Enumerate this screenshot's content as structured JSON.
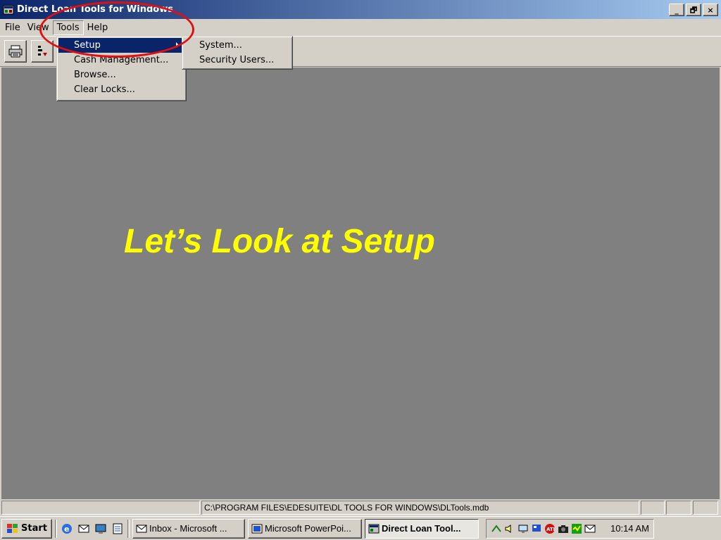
{
  "window": {
    "title": "Direct Loan Tools for Windows",
    "minimize_label": "_",
    "maximize_label": "🗗",
    "close_label": "×"
  },
  "menubar": {
    "items": [
      {
        "label": "File"
      },
      {
        "label": "View"
      },
      {
        "label": "Tools"
      },
      {
        "label": "Help"
      }
    ]
  },
  "tools_menu": {
    "items": [
      {
        "label": "Setup",
        "highlighted": true,
        "has_submenu": true
      },
      {
        "label": "Cash Management..."
      },
      {
        "label": "Browse..."
      },
      {
        "label": "Clear Locks..."
      }
    ]
  },
  "setup_submenu": {
    "items": [
      {
        "label": "System..."
      },
      {
        "label": "Security Users..."
      }
    ]
  },
  "toolbar": {
    "buttons": [
      {
        "icon": "printer-icon"
      },
      {
        "icon": "sort-icon"
      }
    ]
  },
  "slide": {
    "overlay_text": "Let’s Look at Setup",
    "overlay_color": "#ffff00",
    "annotation_color": "#e01010"
  },
  "statusbar": {
    "path": "C:\\PROGRAM FILES\\EDESUITE\\DL TOOLS FOR WINDOWS\\DLTools.mdb"
  },
  "taskbar": {
    "start_label": "Start",
    "tasks": [
      {
        "label": "Inbox - Microsoft ...",
        "pressed": false
      },
      {
        "label": "Microsoft PowerPoi...",
        "pressed": false
      },
      {
        "label": "Direct Loan Tool...",
        "pressed": true
      }
    ],
    "clock": "10:14 AM"
  },
  "colors": {
    "title_gradient_start": "#0a246a",
    "title_gradient_end": "#a6caf0",
    "mdi_background": "#808080",
    "menu_highlight": "#0a246a"
  }
}
